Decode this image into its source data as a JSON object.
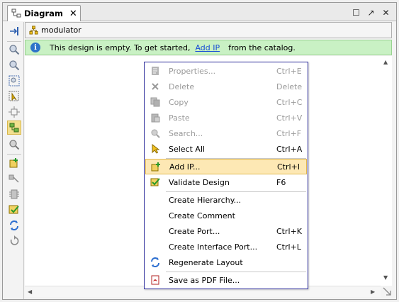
{
  "tab": {
    "title": "Diagram",
    "close": "✕"
  },
  "window_controls": {
    "restore": "☐",
    "float": "↗",
    "close": "✕"
  },
  "breadcrumb": {
    "design": "modulator"
  },
  "banner": {
    "text_before": "This design is empty. To get started,",
    "link": "Add IP",
    "text_after": "from the catalog."
  },
  "menu": {
    "items": [
      {
        "label": "Properties...",
        "shortcut": "Ctrl+E",
        "enabled": false,
        "icon": "properties-icon"
      },
      {
        "label": "Delete",
        "shortcut": "Delete",
        "enabled": false,
        "icon": "delete-icon"
      },
      {
        "label": "Copy",
        "shortcut": "Ctrl+C",
        "enabled": false,
        "icon": "copy-icon"
      },
      {
        "label": "Paste",
        "shortcut": "Ctrl+V",
        "enabled": false,
        "icon": "paste-icon"
      },
      {
        "label": "Search...",
        "shortcut": "Ctrl+F",
        "enabled": false,
        "icon": "search-icon"
      },
      {
        "label": "Select All",
        "shortcut": "Ctrl+A",
        "enabled": true,
        "icon": "select-all-icon"
      },
      {
        "label": "Add IP...",
        "shortcut": "Ctrl+I",
        "enabled": true,
        "highlighted": true,
        "icon": "add-ip-icon"
      },
      {
        "label": "Validate Design",
        "shortcut": "F6",
        "enabled": true,
        "icon": "validate-icon"
      },
      {
        "label": "Create Hierarchy...",
        "shortcut": "",
        "enabled": true,
        "icon": ""
      },
      {
        "label": "Create Comment",
        "shortcut": "",
        "enabled": true,
        "icon": ""
      },
      {
        "label": "Create Port...",
        "shortcut": "Ctrl+K",
        "enabled": true,
        "icon": ""
      },
      {
        "label": "Create Interface Port...",
        "shortcut": "Ctrl+L",
        "enabled": true,
        "icon": ""
      },
      {
        "label": "Regenerate Layout",
        "shortcut": "",
        "enabled": true,
        "icon": "regenerate-icon"
      },
      {
        "label": "Save as PDF File...",
        "shortcut": "",
        "enabled": true,
        "icon": "pdf-icon"
      }
    ]
  },
  "colors": {
    "banner_bg": "#c9f1c4",
    "menu_border": "#2a2a9a",
    "highlight_bg": "#fde8b4",
    "link": "#1a4fd6"
  }
}
